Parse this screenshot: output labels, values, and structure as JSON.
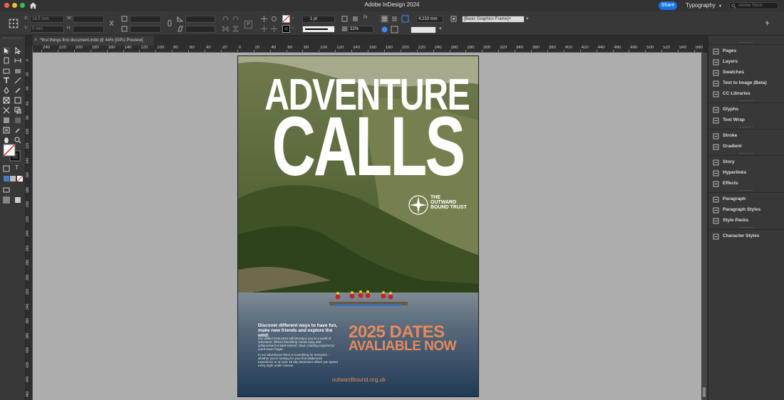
{
  "app": {
    "title": "Adobe InDesign 2024",
    "share_label": "Share",
    "workspace": "Typography",
    "stock_placeholder": "Adobe Stock"
  },
  "control": {
    "x_label": "X:",
    "x_value": "16.5 mm",
    "y_label": "Y:",
    "y_value": "0 mm",
    "w_label": "W:",
    "h_label": "H:",
    "stroke_weight": "1 pt",
    "scale": "32%",
    "offset_value": "4.233 mm",
    "object_style": "[Basic Graphics Frame]+"
  },
  "document": {
    "tab_label": "*first things first document.indd @ 44% [GPU Preview]",
    "close_glyph": "×"
  },
  "ruler": {
    "h_ticks": [
      "240",
      "220",
      "200",
      "180",
      "160",
      "140",
      "120",
      "100",
      "80",
      "60",
      "40",
      "20",
      "0",
      "20",
      "40",
      "60",
      "80",
      "100",
      "120",
      "140",
      "160",
      "180",
      "200",
      "220",
      "240",
      "260",
      "280",
      "300",
      "320",
      "340",
      "360",
      "380",
      "400",
      "420",
      "440",
      "460",
      "480",
      "500",
      "520",
      "540",
      "560"
    ],
    "v_ticks": [
      "0",
      "20",
      "40",
      "60",
      "80",
      "100",
      "120",
      "140",
      "160",
      "180",
      "200",
      "220",
      "240",
      "260",
      "280",
      "300",
      "320",
      "340",
      "360",
      "380",
      "400",
      "420",
      "440",
      "460"
    ]
  },
  "poster": {
    "title_line1": "ADVENTURE",
    "title_line2": "CALLS",
    "logo_line1": "THE",
    "logo_line2": "OUTWARD",
    "logo_line3": "BOUND TRUST",
    "tagline": "Discover different ways to have fun, make new friends and explore the wild!",
    "body1": "Our skilled instructors will introduce you to a world of adventure. Where friendship comes easy and achievement is hard-earned. Have a lasting experience you'll never forget.",
    "body2": "In our adventures there is something for everyone - whether you're looking for your first wilderness experience or an epic 19 day adventure where you spend every night under canvas.",
    "dates_line1": "2025 DATES",
    "dates_line2": "AVALIABLE NOW",
    "website": "outwardbound.org.uk",
    "accent_color": "#e68a5c"
  },
  "panels": [
    {
      "label": "Pages",
      "icon": "pages-icon"
    },
    {
      "label": "Layers",
      "icon": "layers-icon"
    },
    {
      "label": "Swatches",
      "icon": "swatches-icon"
    },
    {
      "label": "Text to Image (Beta)",
      "icon": "text-to-image-icon"
    },
    {
      "label": "CC Libraries",
      "icon": "cc-libraries-icon"
    },
    {
      "label": "Glyphs",
      "icon": "glyphs-icon"
    },
    {
      "label": "Text Wrap",
      "icon": "text-wrap-icon"
    },
    {
      "label": "Stroke",
      "icon": "stroke-icon"
    },
    {
      "label": "Gradient",
      "icon": "gradient-icon"
    },
    {
      "label": "Story",
      "icon": "story-icon"
    },
    {
      "label": "Hyperlinks",
      "icon": "hyperlinks-icon"
    },
    {
      "label": "Effects",
      "icon": "effects-icon"
    },
    {
      "label": "Paragraph",
      "icon": "paragraph-icon"
    },
    {
      "label": "Paragraph Styles",
      "icon": "paragraph-styles-icon"
    },
    {
      "label": "Style Packs",
      "icon": "style-packs-icon"
    },
    {
      "label": "Character Styles",
      "icon": "character-styles-icon"
    }
  ]
}
